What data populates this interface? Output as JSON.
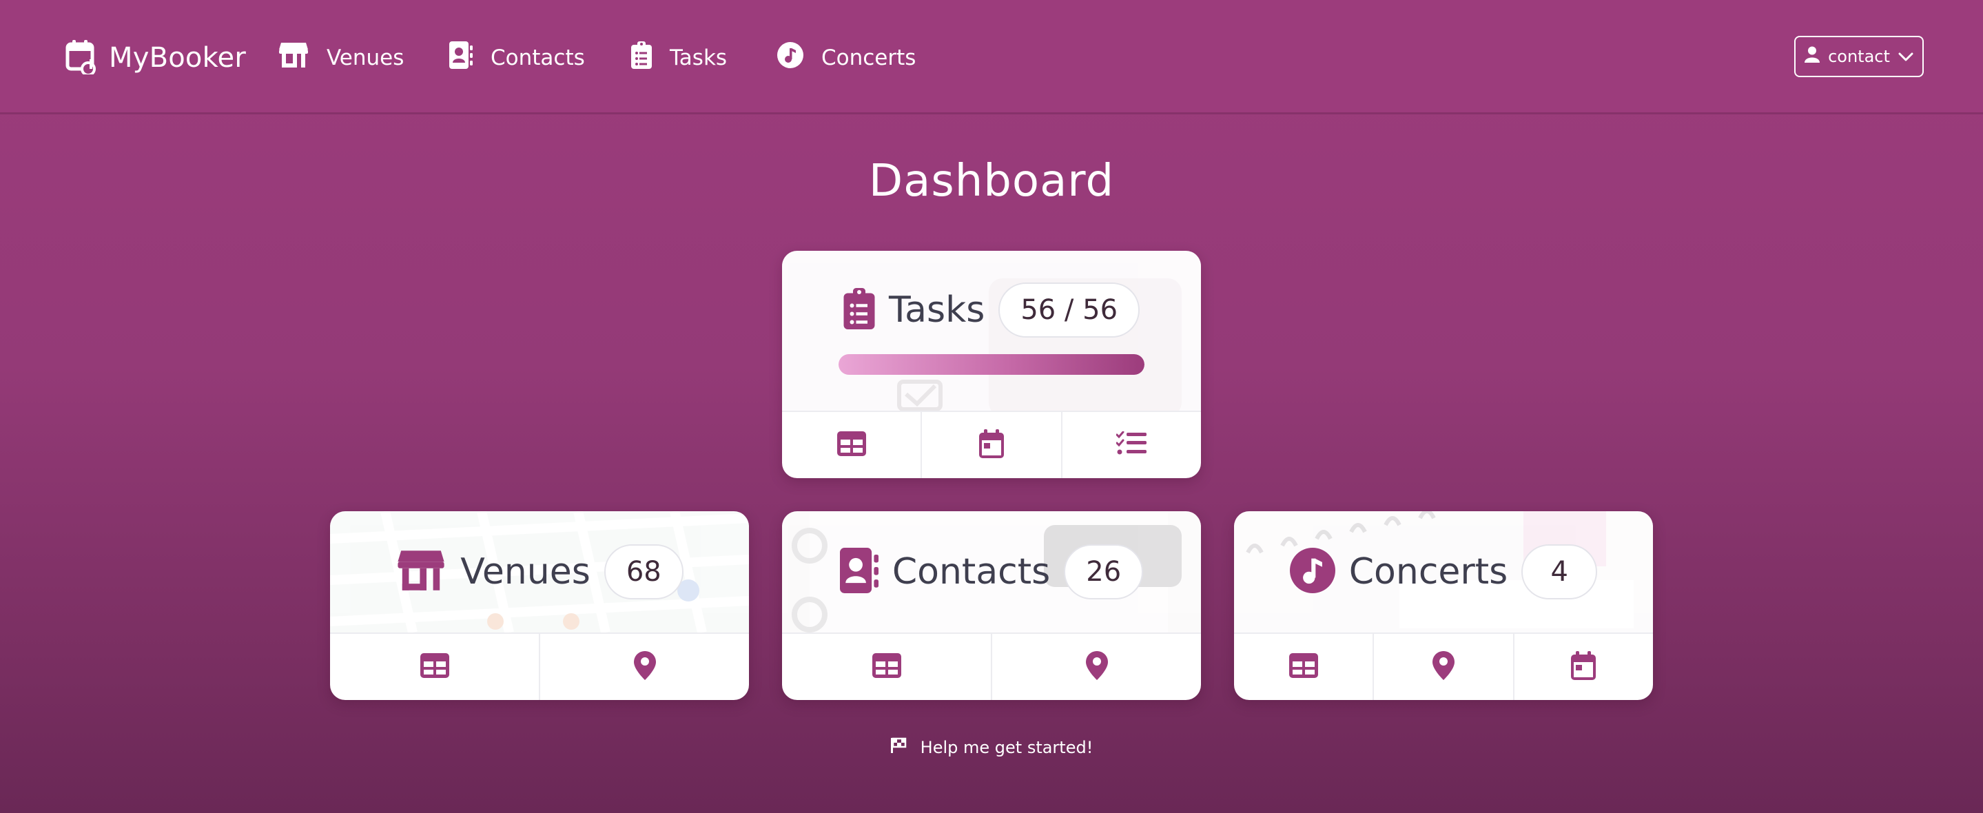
{
  "navbar": {
    "brand": "MyBooker",
    "items": [
      {
        "label": "Venues",
        "icon": "store-icon"
      },
      {
        "label": "Contacts",
        "icon": "address-book-icon"
      },
      {
        "label": "Tasks",
        "icon": "clipboard-list-icon"
      },
      {
        "label": "Concerts",
        "icon": "music-note-icon"
      }
    ],
    "user_label": "contact"
  },
  "page": {
    "title": "Dashboard"
  },
  "cards": {
    "tasks": {
      "title": "Tasks",
      "count": "56 / 56",
      "progress_percent": 100,
      "actions": [
        "table-icon",
        "calendar-icon",
        "checklist-icon"
      ]
    },
    "venues": {
      "title": "Venues",
      "count": "68",
      "actions": [
        "table-icon",
        "map-pin-icon"
      ]
    },
    "contacts": {
      "title": "Contacts",
      "count": "26",
      "actions": [
        "table-icon",
        "map-pin-icon"
      ]
    },
    "concerts": {
      "title": "Concerts",
      "count": "4",
      "actions": [
        "table-icon",
        "map-pin-icon",
        "calendar-icon"
      ]
    }
  },
  "help": {
    "label": "Help me get started!"
  },
  "colors": {
    "primary": "#9c3c7c",
    "background": "#943a77",
    "card": "#ffffff",
    "text": "#3f3f4f"
  }
}
